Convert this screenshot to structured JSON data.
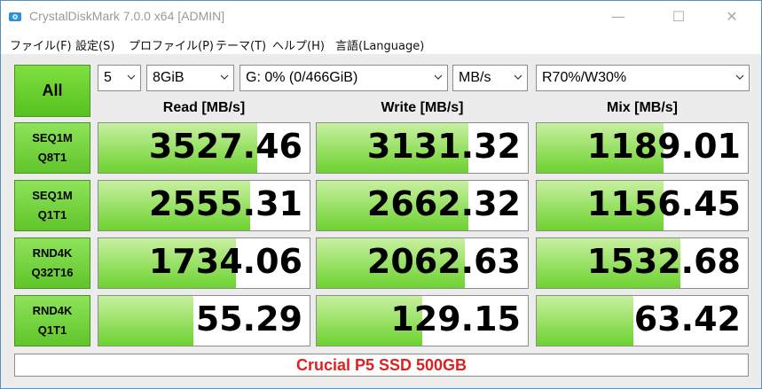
{
  "window": {
    "title": "CrystalDiskMark 7.0.0 x64 [ADMIN]",
    "icon": "disk-app-icon",
    "minimize": "—",
    "maximize": "☐",
    "close": "✕"
  },
  "menu": [
    {
      "label": "ファイル(F)"
    },
    {
      "label": "設定(S)"
    },
    {
      "label": "プロファイル(P)"
    },
    {
      "label": "テーマ(T)"
    },
    {
      "label": "ヘルプ(H)"
    },
    {
      "label": "言語(Language)"
    }
  ],
  "controls": {
    "all_button": "All",
    "count": "5",
    "size": "8GiB",
    "drive": "G: 0% (0/466GiB)",
    "unit": "MB/s",
    "mix": "R70%/W30%"
  },
  "headers": {
    "read": "Read [MB/s]",
    "write": "Write [MB/s]",
    "mix": "Mix [MB/s]"
  },
  "rows": [
    {
      "line1": "SEQ1M",
      "line2": "Q8T1",
      "read": {
        "value": "3527.46",
        "fill": 0.75
      },
      "write": {
        "value": "3131.32",
        "fill": 0.72
      },
      "mix": {
        "value": "1189.01",
        "fill": 0.6
      }
    },
    {
      "line1": "SEQ1M",
      "line2": "Q1T1",
      "read": {
        "value": "2555.31",
        "fill": 0.72
      },
      "write": {
        "value": "2662.32",
        "fill": 0.72
      },
      "mix": {
        "value": "1156.45",
        "fill": 0.6
      }
    },
    {
      "line1": "RND4K",
      "line2": "Q32T16",
      "read": {
        "value": "1734.06",
        "fill": 0.65
      },
      "write": {
        "value": "2062.63",
        "fill": 0.7
      },
      "mix": {
        "value": "1532.68",
        "fill": 0.68
      }
    },
    {
      "line1": "RND4K",
      "line2": "Q1T1",
      "read": {
        "value": "55.29",
        "fill": 0.45
      },
      "write": {
        "value": "129.15",
        "fill": 0.5
      },
      "mix": {
        "value": "63.42",
        "fill": 0.46
      }
    }
  ],
  "comment": "Crucial P5 SSD 500GB",
  "colors": {
    "accent_green": "#6dd230",
    "comment_red": "#e02020"
  }
}
